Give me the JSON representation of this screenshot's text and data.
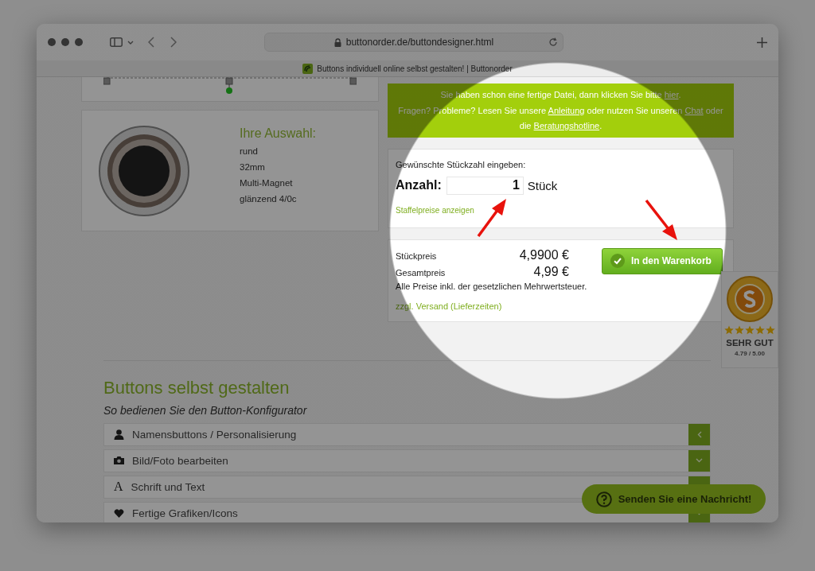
{
  "browser": {
    "url": "buttonorder.de/buttondesigner.html",
    "tab_title": "Buttons individuell online selbst gestalten! | Buttonorder"
  },
  "selection": {
    "heading": "Ihre Auswahl:",
    "options": [
      "rund",
      "32mm",
      "Multi-Magnet",
      "glänzend 4/0c"
    ]
  },
  "info_box": {
    "paragraphs": [
      [
        {
          "text": "Sie haben schon eine fertige Datei, dann klicken Sie bitte ",
          "kind": "plain"
        },
        {
          "text": "hier",
          "kind": "link"
        },
        {
          "text": ".",
          "kind": "plain"
        }
      ],
      [
        {
          "text": "Fragen? Probleme? Lesen Sie unsere ",
          "kind": "plain"
        },
        {
          "text": "Anleitung",
          "kind": "link"
        },
        {
          "text": " oder nutzen Sie unseren ",
          "kind": "plain"
        },
        {
          "text": "Chat",
          "kind": "link"
        },
        {
          "text": " oder die ",
          "kind": "plain"
        },
        {
          "text": "Beratungshotline",
          "kind": "link"
        },
        {
          "text": ".",
          "kind": "plain"
        }
      ]
    ]
  },
  "quantity": {
    "prompt": "Gewünschte Stückzahl eingeben:",
    "label": "Anzahl:",
    "value": "1",
    "unit": "Stück",
    "tier_link": "Staffelpreise anzeigen"
  },
  "pricing": {
    "rows": [
      {
        "label": "Stückpreis",
        "value": "4,9900 €"
      },
      {
        "label": "Gesamtpreis",
        "value": "4,99 €"
      }
    ],
    "tax_note": "Alle Preise inkl. der gesetzlichen Mehrwertsteuer.",
    "shipping_link": "zzgl. Versand (Lieferzeiten)",
    "cart_button": "In den Warenkorb"
  },
  "rating_badge": {
    "stars": 5,
    "verdict": "SEHR GUT",
    "score": "4.79 / 5.00"
  },
  "guide": {
    "title": "Buttons selbst gestalten",
    "subtitle": "So bedienen Sie den Button-Konfigurator",
    "items": [
      {
        "kind": "person",
        "label": "Namensbuttons / Personalisierung",
        "expanded": true
      },
      {
        "kind": "camera",
        "label": "Bild/Foto bearbeiten",
        "expanded": false
      },
      {
        "kind": "letter",
        "glyph": "A",
        "label": "Schrift und Text"
      },
      {
        "kind": "heart",
        "label": "Fertige Grafiken/Icons",
        "expanded": false
      }
    ]
  },
  "chat_button": "Senden Sie eine Nachricht!"
}
